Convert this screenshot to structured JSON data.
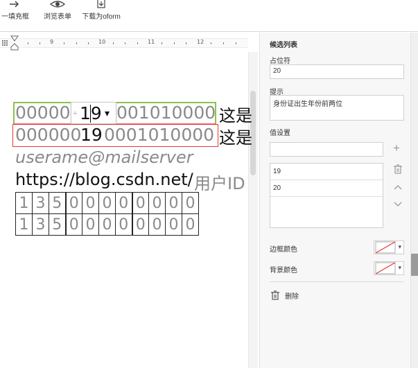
{
  "toolbar": {
    "fill_frame_label": "一填充框",
    "browse_form_label": "浏览表单",
    "download_oform_label": "下载为oform"
  },
  "ruler": {
    "labels": [
      "9",
      "10",
      "11",
      "12"
    ]
  },
  "document": {
    "line1": {
      "prefix": "00000",
      "combo_value": "19",
      "suffix": "001010000",
      "trailing_text": "这是"
    },
    "line2": {
      "prefix": "000000",
      "value": "19",
      "suffix": "0001010000",
      "trailing_text": "这是"
    },
    "line3": {
      "placeholder": "userame@mailserver"
    },
    "line4": {
      "url": "https://blog.csdn.net/",
      "trailing_text": "用户ID"
    },
    "grid_rows": [
      [
        "1",
        "3",
        "5",
        "0",
        "0",
        "0",
        "0",
        "0",
        "0",
        "0",
        "0"
      ],
      [
        "1",
        "3",
        "5",
        "0",
        "0",
        "0",
        "0",
        "0",
        "0",
        "0",
        "0"
      ]
    ]
  },
  "panel": {
    "title": "候选列表",
    "placeholder_label": "占位符",
    "placeholder_value": "20",
    "hint_label": "提示",
    "hint_value": "身份证出生年份前两位",
    "value_settings_label": "值设置",
    "new_value": "",
    "options": [
      "19",
      "20"
    ],
    "border_color_label": "边框颜色",
    "background_color_label": "背景颜色",
    "delete_label": "删除"
  },
  "colors": {
    "highlight_green": "#8bc34a",
    "highlight_red": "#e53935",
    "placeholder_gray": "#8a8a8a"
  }
}
